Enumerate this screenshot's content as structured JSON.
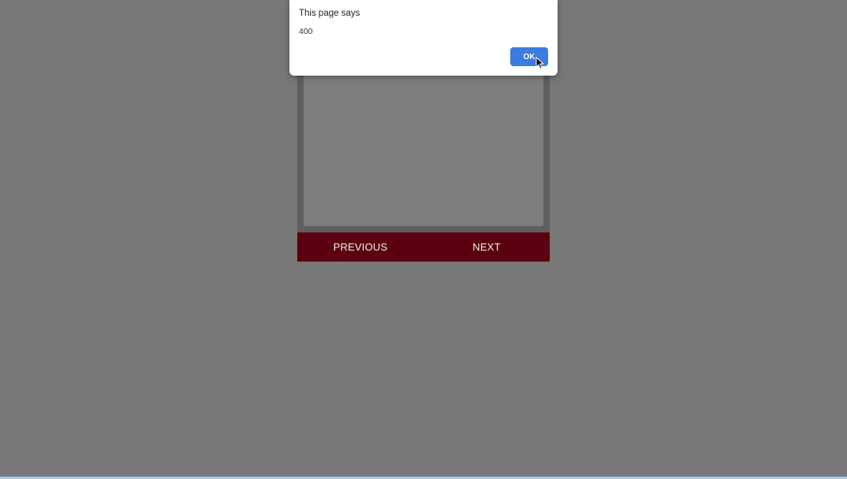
{
  "dialog": {
    "title": "This page says",
    "message": "400",
    "ok_label": "OK"
  },
  "slider": {
    "image_icon": "slide-photo-church-sky",
    "previous_label": "PREVIOUS",
    "next_label": "NEXT"
  },
  "colors": {
    "backdrop": "#777777",
    "nav_bar": "#5b0010",
    "ok_button": "#3c7be0"
  }
}
